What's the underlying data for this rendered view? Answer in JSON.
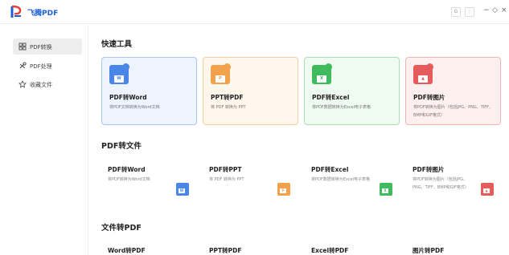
{
  "app": {
    "name": "飞腾PDF"
  },
  "titlebar": {
    "btn1": "G",
    "btn2": "⋮",
    "minimize": "−",
    "maximize": "◇",
    "close": "×"
  },
  "sidebar": {
    "items": [
      {
        "label": "PDF转换",
        "icon": "grid-icon",
        "active": true
      },
      {
        "label": "PDF处理",
        "icon": "tools-icon",
        "active": false
      },
      {
        "label": "收藏文件",
        "icon": "star-icon",
        "active": false
      }
    ]
  },
  "colors": {
    "blue": "#4a86e8",
    "orange": "#f2a24b",
    "green": "#3fba5d",
    "red": "#e65b5b",
    "brand": "#1e5fd6"
  },
  "quick_tools": {
    "title": "快速工具",
    "cards": [
      {
        "title": "PDF转Word",
        "desc": "将PDF文档转换为Word文档",
        "badge": "W",
        "icon": "pdf-to-word-icon"
      },
      {
        "title": "PPT转PDF",
        "desc": "将 PDF 转换为 PPT",
        "badge": "P",
        "icon": "ppt-to-pdf-icon"
      },
      {
        "title": "PDF转Excel",
        "desc": "将PDF数据转换为Excel电子表格",
        "badge": "X",
        "icon": "pdf-to-excel-icon"
      },
      {
        "title": "PDF转图片",
        "desc": "将PDF转换为图片（包括JPG、PNG、TIFF、BMP和GIF格式）",
        "badge": "▲",
        "icon": "pdf-to-image-icon"
      }
    ]
  },
  "pdf_to_file": {
    "title": "PDF转文件",
    "cards": [
      {
        "title": "PDF转Word",
        "desc": "将PDF转换为Word文档",
        "badge": "W",
        "icon": "word-icon"
      },
      {
        "title": "PDF转PPT",
        "desc": "将 PDF 转换为 PPT",
        "badge": "P",
        "icon": "ppt-icon"
      },
      {
        "title": "PDF转Excel",
        "desc": "将PDF数据转换为Excel电子表格",
        "badge": "X",
        "icon": "excel-icon"
      },
      {
        "title": "PDF转图片",
        "desc": "将PDF转换为图片（包括JPG、PNG、TIFF、BMP和GIF格式）",
        "badge": "▲",
        "icon": "image-icon"
      }
    ]
  },
  "file_to_pdf": {
    "title": "文件转PDF",
    "cards": [
      {
        "title": "Word转PDF"
      },
      {
        "title": "PPT转PDF"
      },
      {
        "title": "Excel转PDF"
      },
      {
        "title": "图片转PDF"
      }
    ]
  }
}
